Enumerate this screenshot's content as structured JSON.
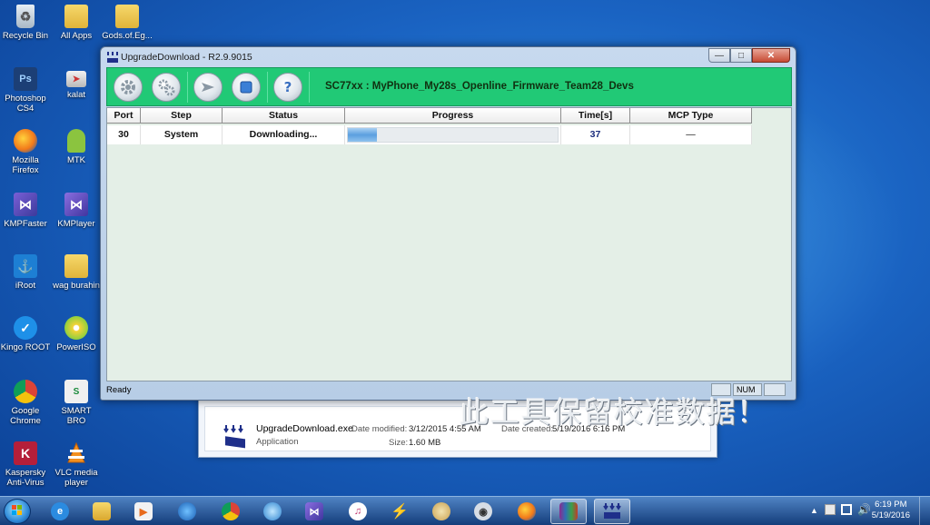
{
  "desktop": {
    "icons": [
      {
        "label": "Recycle Bin",
        "icon": "recycle-bin-icon"
      },
      {
        "label": "All Apps",
        "icon": "folder-icon"
      },
      {
        "label": "Gods.of.Eg...",
        "icon": "folder-icon"
      },
      {
        "label": "Photoshop CS4",
        "icon": "photoshop-icon"
      },
      {
        "label": "kalat",
        "icon": "shortcut-icon"
      },
      {
        "label": "Mozilla Firefox",
        "icon": "firefox-icon"
      },
      {
        "label": "MTK",
        "icon": "android-icon"
      },
      {
        "label": "KMPFaster",
        "icon": "kmp-icon"
      },
      {
        "label": "KMPlayer",
        "icon": "kmplayer-icon"
      },
      {
        "label": "iRoot",
        "icon": "iroot-icon"
      },
      {
        "label": "wag burahin",
        "icon": "folder-icon"
      },
      {
        "label": "Kingo ROOT",
        "icon": "kingo-icon"
      },
      {
        "label": "PowerISO",
        "icon": "poweriso-icon"
      },
      {
        "label": "Google Chrome",
        "icon": "chrome-icon"
      },
      {
        "label": "SMART BRO",
        "icon": "smartbro-icon"
      },
      {
        "label": "Kaspersky Anti-Virus",
        "icon": "kaspersky-icon"
      },
      {
        "label": "VLC media player",
        "icon": "vlc-icon"
      }
    ]
  },
  "explorer": {
    "file_name": "UpgradeDownload.exe",
    "file_type": "Application",
    "date_modified_label": "Date modified:",
    "date_modified": "3/12/2015 4:55 AM",
    "date_created_label": "Date created:",
    "date_created": "5/19/2016 6:16 PM",
    "size_label": "Size:",
    "size": "1.60 MB"
  },
  "app": {
    "title": "UpgradeDownload - R2.9.9015",
    "window_buttons": {
      "minimize": "—",
      "maximize": "□",
      "close": "✕"
    },
    "toolbar": {
      "title": "SC77xx : MyPhone_My28s_Openline_Firmware_Team28_Devs",
      "buttons": [
        "settings-icon",
        "advanced-settings-icon",
        "start-download-icon",
        "stop-icon",
        "help-icon"
      ]
    },
    "table": {
      "columns": [
        "Port",
        "Step",
        "Status",
        "Progress",
        "Time[s]",
        "MCP Type"
      ],
      "rows": [
        {
          "port": "30",
          "step": "System",
          "status": "Downloading...",
          "progress": 0.14,
          "time": "37",
          "mcp_type": "—"
        }
      ]
    },
    "watermark": "此工具保留校准数据！",
    "status": {
      "ready": "Ready",
      "num": "NUM"
    }
  },
  "taskbar": {
    "items": [
      "ie-icon",
      "explorer-icon",
      "media-player-icon",
      "globe-icon",
      "chrome-icon",
      "ie-alt-icon",
      "kmplayer-icon",
      "itunes-icon",
      "flash-icon",
      "paint-icon",
      "camera-icon",
      "firefox-icon",
      "winrar-icon",
      "upgradedownload-icon"
    ],
    "active_item": 13,
    "clock_time": "6:19 PM",
    "clock_date": "5/19/2016"
  },
  "colors": {
    "toolbar_bg": "#21c976",
    "grid_bg": "#e4efe7",
    "progress_fill": "#5b9fdf"
  }
}
